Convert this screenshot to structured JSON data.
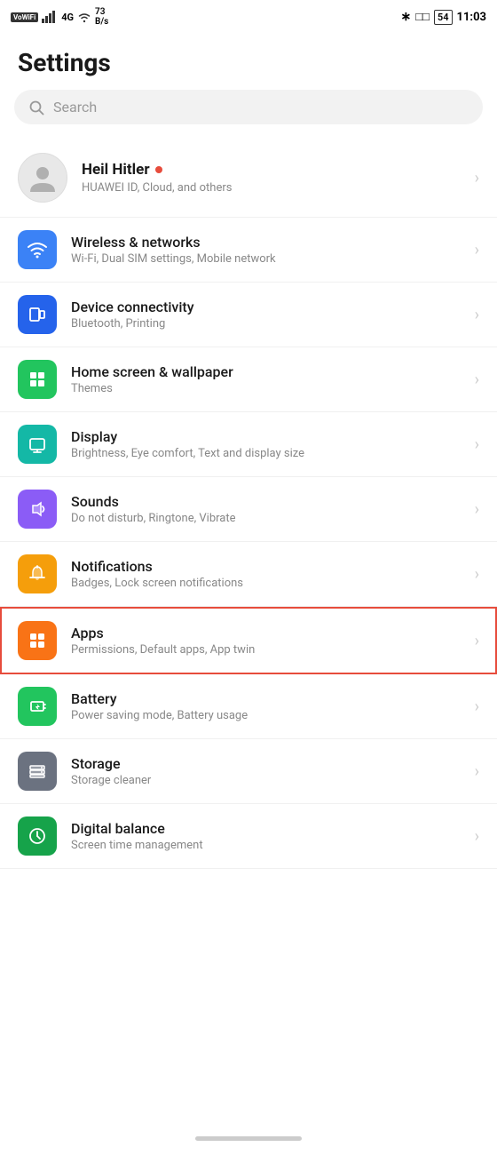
{
  "statusBar": {
    "left": {
      "vowifi": "VoWiFi",
      "signal": "4G",
      "wifi": "WiFi",
      "speed": "73\nB/s"
    },
    "right": {
      "bluetooth": "BT",
      "battery": "54",
      "time": "11:03"
    }
  },
  "page": {
    "title": "Settings"
  },
  "search": {
    "placeholder": "Search"
  },
  "profile": {
    "name": "Heil Hitler",
    "subtitle": "HUAWEI ID, Cloud, and others",
    "hasNotification": true
  },
  "settingsItems": [
    {
      "id": "wireless",
      "iconColor": "icon-blue",
      "title": "Wireless & networks",
      "subtitle": "Wi-Fi, Dual SIM settings, Mobile network",
      "highlighted": false
    },
    {
      "id": "device",
      "iconColor": "icon-blue-dark",
      "title": "Device connectivity",
      "subtitle": "Bluetooth, Printing",
      "highlighted": false
    },
    {
      "id": "homescreen",
      "iconColor": "icon-green",
      "title": "Home screen & wallpaper",
      "subtitle": "Themes",
      "highlighted": false
    },
    {
      "id": "display",
      "iconColor": "icon-teal",
      "title": "Display",
      "subtitle": "Brightness, Eye comfort, Text and display size",
      "highlighted": false
    },
    {
      "id": "sounds",
      "iconColor": "icon-purple",
      "title": "Sounds",
      "subtitle": "Do not disturb, Ringtone, Vibrate",
      "highlighted": false
    },
    {
      "id": "notifications",
      "iconColor": "icon-yellow",
      "title": "Notifications",
      "subtitle": "Badges, Lock screen notifications",
      "highlighted": false
    },
    {
      "id": "apps",
      "iconColor": "icon-orange",
      "title": "Apps",
      "subtitle": "Permissions, Default apps, App twin",
      "highlighted": true
    },
    {
      "id": "battery",
      "iconColor": "icon-green-battery",
      "title": "Battery",
      "subtitle": "Power saving mode, Battery usage",
      "highlighted": false
    },
    {
      "id": "storage",
      "iconColor": "icon-gray",
      "title": "Storage",
      "subtitle": "Storage cleaner",
      "highlighted": false
    },
    {
      "id": "digital",
      "iconColor": "icon-green-dark",
      "title": "Digital balance",
      "subtitle": "Screen time management",
      "highlighted": false
    }
  ]
}
